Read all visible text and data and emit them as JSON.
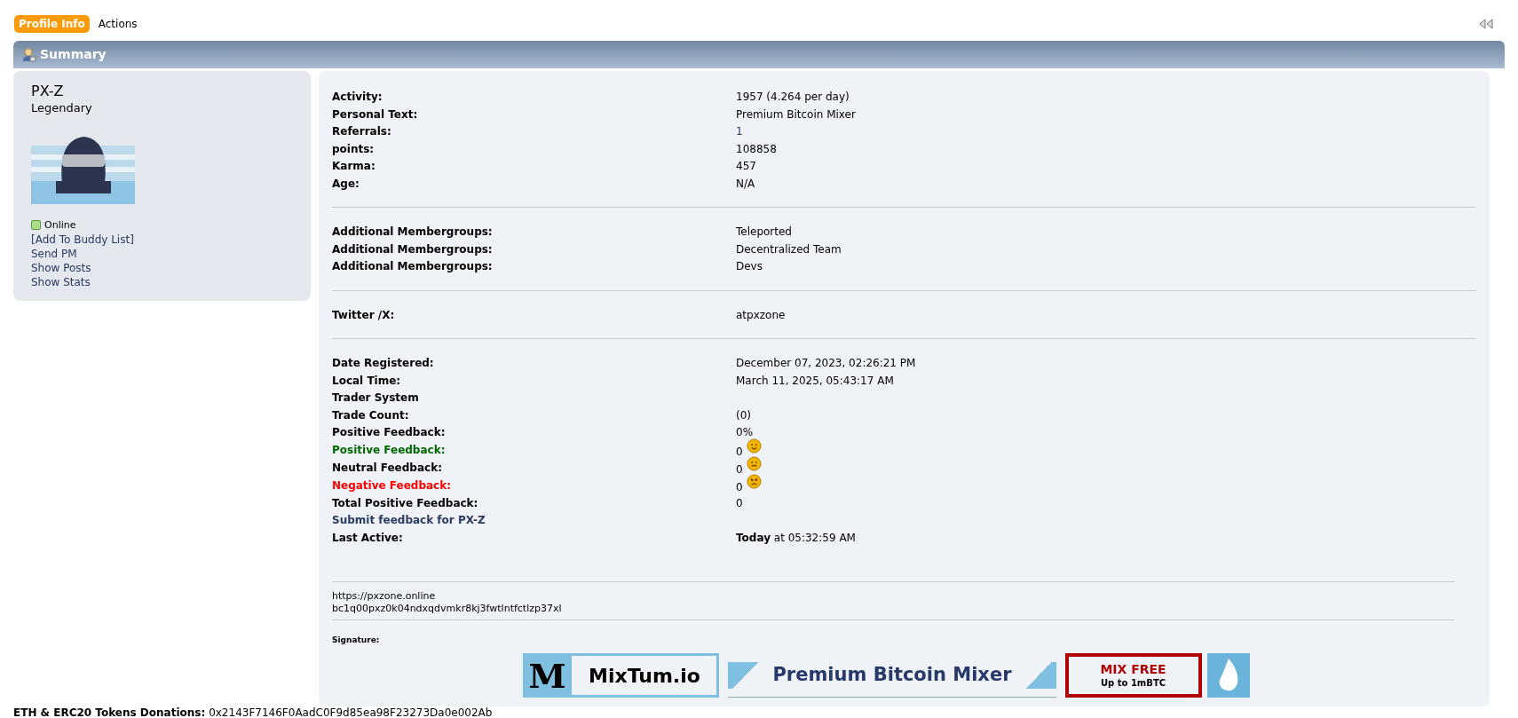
{
  "tabs": [
    {
      "label": "Profile Info",
      "selected": true
    },
    {
      "label": "Actions",
      "selected": false
    }
  ],
  "section_title": "Summary",
  "profile": {
    "name": "PX-Z",
    "rank": "Legendary",
    "status": {
      "label": "Online",
      "online": true
    },
    "links": [
      "[Add To Buddy List]",
      "Send PM",
      "Show Posts",
      "Show Stats"
    ]
  },
  "sections": [
    {
      "rows": [
        {
          "label": "Activity:",
          "value": "1957 (4.264 per day)",
          "kind": "plain"
        },
        {
          "label": "Personal Text:",
          "value": "Premium Bitcoin Mixer",
          "kind": "plain"
        },
        {
          "label": "Referrals:",
          "value": "1",
          "kind": "link_value"
        },
        {
          "label": "points:",
          "value": "108858",
          "kind": "plain"
        },
        {
          "label": "Karma:",
          "value": "457",
          "kind": "plain"
        },
        {
          "label": "Age:",
          "value": "N/A",
          "kind": "plain"
        }
      ]
    },
    {
      "rows": [
        {
          "label": "Additional Membergroups:",
          "value": "Teleported",
          "kind": "plain"
        },
        {
          "label": "Additional Membergroups:",
          "value": "Decentralized Team",
          "kind": "plain"
        },
        {
          "label": "Additional Membergroups:",
          "value": "Devs",
          "kind": "plain"
        }
      ]
    },
    {
      "rows": [
        {
          "label": "Twitter /X:",
          "value": "atpxzone",
          "kind": "plain"
        }
      ]
    },
    {
      "rows": [
        {
          "label": "Date Registered:",
          "value": "December 07, 2023, 02:26:21 PM",
          "kind": "plain"
        },
        {
          "label": "Local Time:",
          "value": "March 11, 2025, 05:43:17 AM",
          "kind": "plain"
        },
        {
          "label": "Trader System",
          "kind": "heading"
        },
        {
          "label": "Trade Count:",
          "value": "(0)",
          "kind": "plain"
        },
        {
          "label": "Positive Feedback:",
          "value": "0%",
          "kind": "plain"
        },
        {
          "label": "Positive Feedback:",
          "value": "0",
          "kind": "positive"
        },
        {
          "label": "Neutral Feedback:",
          "value": "0",
          "kind": "neutral"
        },
        {
          "label": "Negative Feedback:",
          "value": "0",
          "kind": "negative"
        },
        {
          "label": "Total Positive Feedback:",
          "value": "0",
          "kind": "plain"
        },
        {
          "label": "Submit feedback for PX-Z",
          "kind": "link"
        },
        {
          "label": "Last Active:",
          "value": "**Today** at 05:32:59 AM",
          "kind": "plain"
        }
      ]
    }
  ],
  "website_lines": [
    "https://pxzone.online",
    "bc1q00pxz0k04ndxqdvmkr8kj3fwtlntfctlzp37xl"
  ],
  "signature_label": "Signature:",
  "signature": {
    "logo_letter": "M",
    "site": "MixTum.io",
    "slogan": "Premium Bitcoin Mixer",
    "offer_title": "MIX FREE",
    "offer_note": "Up to 1mBTC"
  },
  "donation": {
    "label": "ETH & ERC20 Tokens Donations:",
    "address": "0x2143F7146F0AadC0F9d85ea98F23273Da0e002Ab"
  }
}
